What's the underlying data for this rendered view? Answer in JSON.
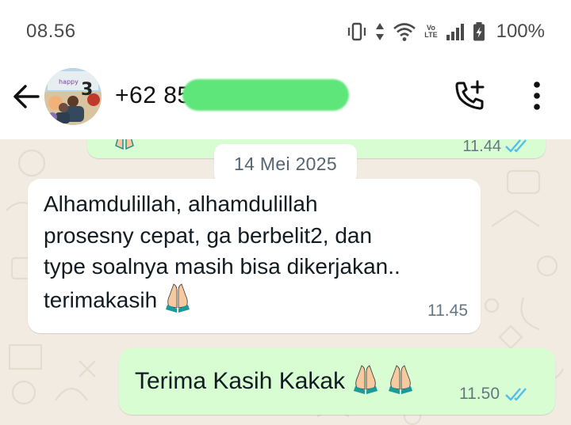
{
  "status_bar": {
    "time": "08.56",
    "battery": "100%",
    "volte_top": "Vo",
    "volte_bottom": "LTE"
  },
  "header": {
    "contact_name": "+62 85",
    "icons": [
      "back-arrow-icon",
      "avatar",
      "add-call-icon",
      "more-vert-icon"
    ]
  },
  "chat": {
    "prev_message": {
      "time": "11.44",
      "status": "read"
    },
    "date_chip": "14 Mei 2025",
    "incoming": {
      "lines": [
        "Alhamdulillah, alhamdulillah",
        "prosesny cepat, ga berbelit2, dan",
        "type soalnya masih bisa dikerjakan..",
        "terimakasih"
      ],
      "time": "11.45"
    },
    "outgoing": {
      "text": "Terima Kasih Kakak",
      "time": "11.50",
      "status": "read"
    }
  },
  "colors": {
    "outgoing_bubble": "#d9fdd3",
    "incoming_bubble": "#ffffff",
    "read_ticks": "#53bdeb",
    "chat_bg": "#f1ebe1"
  }
}
